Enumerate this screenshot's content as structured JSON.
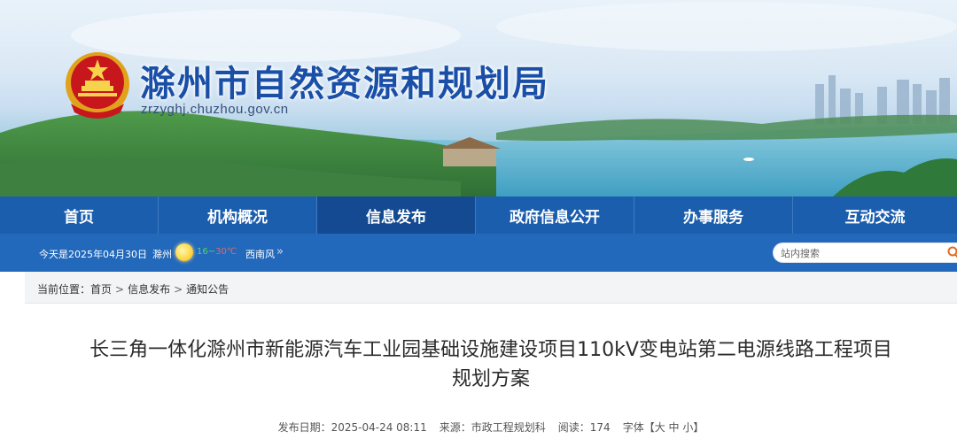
{
  "header": {
    "site_name": "滁州市自然资源和规划局",
    "domain": "zrzyghj.chuzhou.gov.cn"
  },
  "nav": {
    "items": [
      {
        "label": "首页"
      },
      {
        "label": "机构概况"
      },
      {
        "label": "信息发布"
      },
      {
        "label": "政府信息公开"
      },
      {
        "label": "办事服务"
      },
      {
        "label": "互动交流"
      }
    ],
    "active_index": 2
  },
  "infobar": {
    "today": "今天是2025年04月30日",
    "city": "滁州",
    "weather_icon": "sun-icon",
    "temp_low": "16",
    "temp_sep": "~",
    "temp_high": "30℃",
    "wind": "西南风",
    "wind_arrow": "»"
  },
  "search": {
    "placeholder": "站内搜索",
    "icon": "search-icon"
  },
  "breadcrumb": {
    "label": "当前位置：",
    "items": [
      "首页",
      "信息发布",
      "通知公告"
    ],
    "separator": ">"
  },
  "article": {
    "title_line1": "长三角一体化滁州市新能源汽车工业园基础设施建设项目110kV变电站第二电源线路工程项目",
    "title_line2": "规划方案",
    "meta": {
      "date_label": "发布日期：",
      "date": "2025-04-24 08:11",
      "source_label": "来源：",
      "source": "市政工程规划科",
      "views_label": "阅读：",
      "views": "174",
      "font_label": "字体【",
      "font_large": "大",
      "font_medium": "中",
      "font_small": "小",
      "font_close": "】"
    }
  },
  "colors": {
    "nav_bg": "#1c5eae",
    "nav_active_bg": "#134a91",
    "infobar_bg": "#2369bb",
    "site_name": "#1a4fa8"
  }
}
